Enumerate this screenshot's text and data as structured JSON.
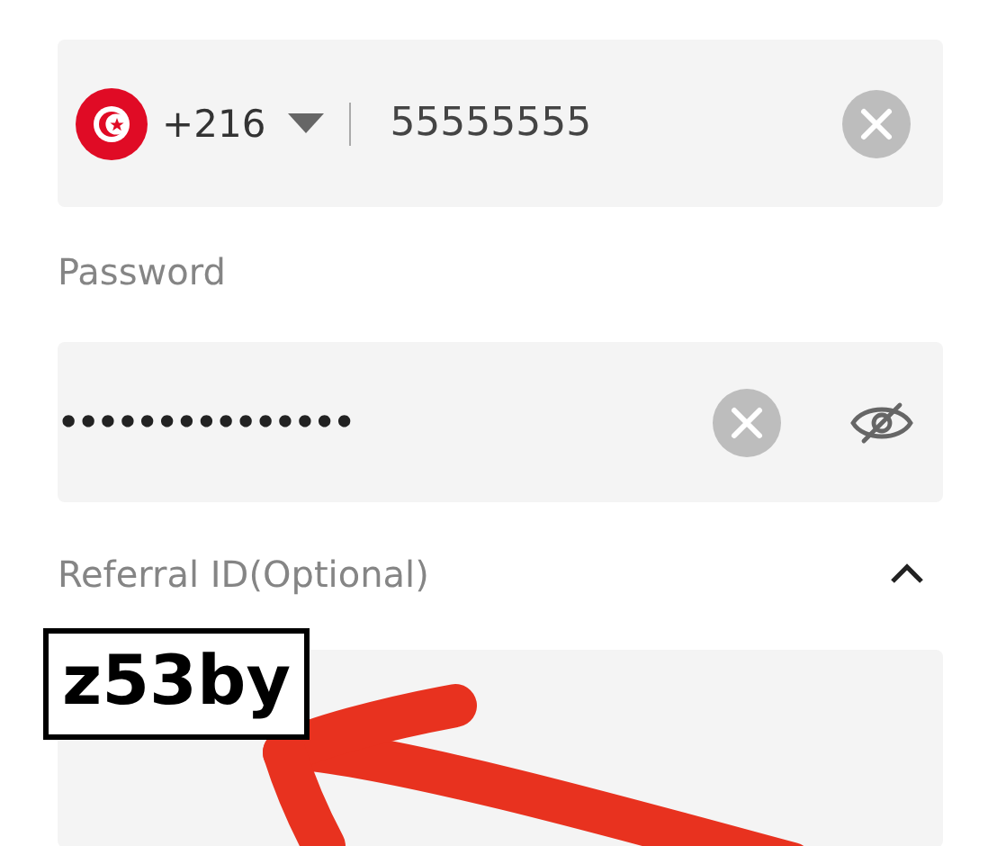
{
  "phone": {
    "country_code": "+216",
    "value": "55555555"
  },
  "password": {
    "label": "Password",
    "value": "•••••••••••••••",
    "visible": false
  },
  "referral": {
    "label": "Referral ID(Optional)",
    "expanded": true
  },
  "annotation": {
    "text": "z53by"
  }
}
